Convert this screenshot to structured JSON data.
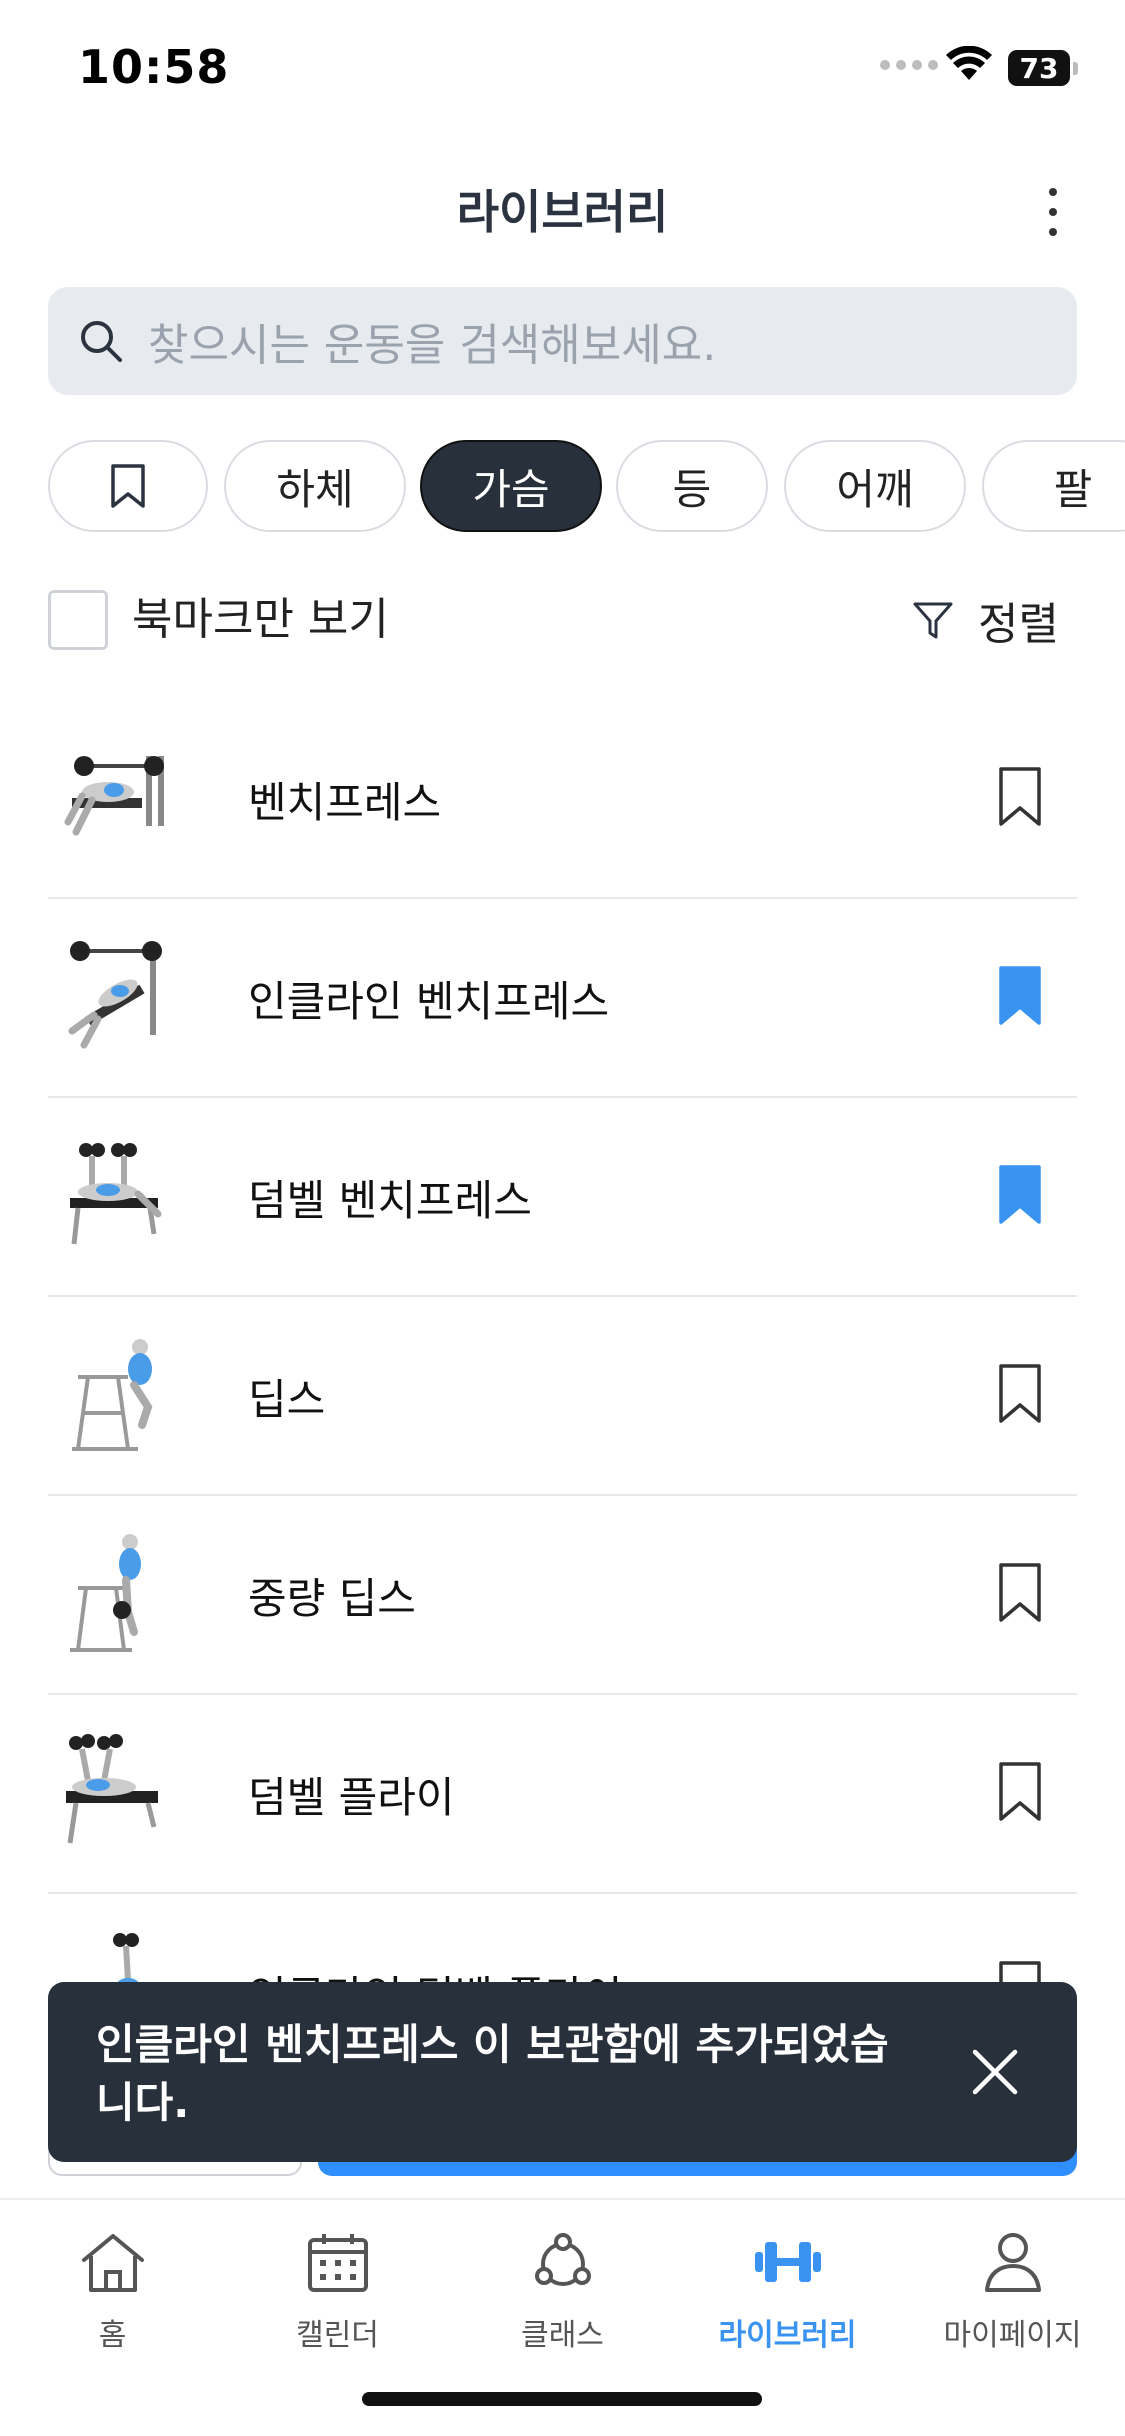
{
  "status_bar": {
    "time": "10:58",
    "battery": "73"
  },
  "header": {
    "title": "라이브러리"
  },
  "search": {
    "placeholder": "찾으시는 운동을 검색해보세요."
  },
  "categories": [
    {
      "label": "",
      "icon": "bookmark-icon"
    },
    {
      "label": "하체"
    },
    {
      "label": "가슴",
      "selected": true
    },
    {
      "label": "등"
    },
    {
      "label": "어깨"
    },
    {
      "label": "팔"
    }
  ],
  "filter": {
    "bookmark_only_label": "북마크만 보기",
    "sort_label": "정렬"
  },
  "exercises": [
    {
      "name": "벤치프레스",
      "bookmarked": false
    },
    {
      "name": "인클라인 벤치프레스",
      "bookmarked": true
    },
    {
      "name": "덤벨 벤치프레스",
      "bookmarked": true
    },
    {
      "name": "딥스",
      "bookmarked": false
    },
    {
      "name": "중량 딥스",
      "bookmarked": false
    },
    {
      "name": "덤벨 플라이",
      "bookmarked": false
    },
    {
      "name": "인클라인 덤벨 플라이",
      "bookmarked": false
    }
  ],
  "toast": {
    "message": "인클라인 벤치프레스 이 보관함에 추가되었습니다."
  },
  "tabbar": {
    "items": [
      {
        "label": "홈",
        "icon": "home-icon"
      },
      {
        "label": "캘린더",
        "icon": "calendar-icon"
      },
      {
        "label": "클래스",
        "icon": "class-network-icon"
      },
      {
        "label": "라이브러리",
        "icon": "dumbbell-icon",
        "active": true
      },
      {
        "label": "마이페이지",
        "icon": "person-icon"
      }
    ]
  },
  "colors": {
    "accent": "#3a93f0",
    "bookmark_active": "#3a93f0",
    "chip_active": "#28313b",
    "toast_bg": "#27303b"
  }
}
